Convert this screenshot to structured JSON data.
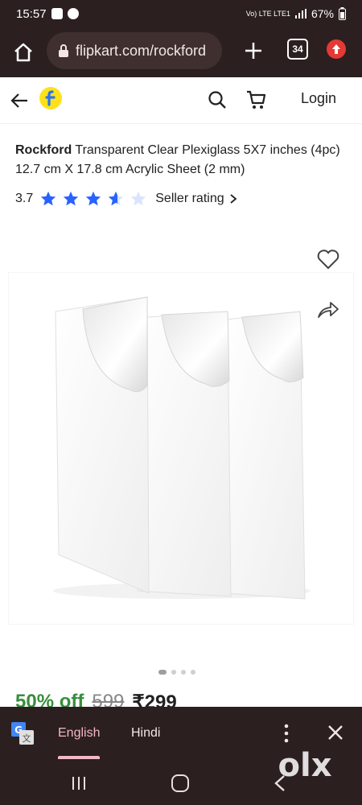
{
  "status_bar": {
    "time": "15:57",
    "network": "Vo) LTE LTE1",
    "battery": "67%"
  },
  "browser": {
    "url": "flipkart.com/rockford",
    "tab_count": "34",
    "icons": [
      "home-icon",
      "lock-icon",
      "plus-icon",
      "tabs-icon",
      "update-icon"
    ]
  },
  "header": {
    "login_label": "Login",
    "icons": [
      "back-arrow-icon",
      "flipkart-logo",
      "search-icon",
      "cart-icon"
    ]
  },
  "product": {
    "brand": "Rockford",
    "title": " Transparent Clear Plexiglass 5X7 inches (4pc) 12.7 cm X 17.8 cm Acrylic Sheet (2 mm)",
    "rating": "3.7",
    "rating_stars_filled": 3.7,
    "rating_stars_total": 5,
    "seller_rating_label": "Seller rating",
    "discount": "50% off",
    "mrp": "599",
    "price": "₹299",
    "image_count": 4,
    "active_image": 1
  },
  "translate": {
    "lang_selected": "English",
    "lang_other": "Hindi",
    "icons": [
      "google-translate-icon",
      "more-vert-icon",
      "close-icon"
    ]
  },
  "nav": {
    "icons": [
      "recent-apps-icon",
      "home-nav-icon",
      "back-nav-icon"
    ]
  },
  "watermark": "olx",
  "colors": {
    "chrome_bg": "#2b1f1f",
    "star": "#2962ff",
    "discount": "#388e3c",
    "accent_pink": "#f2b8c6",
    "logo_yellow": "#ffe11b"
  }
}
